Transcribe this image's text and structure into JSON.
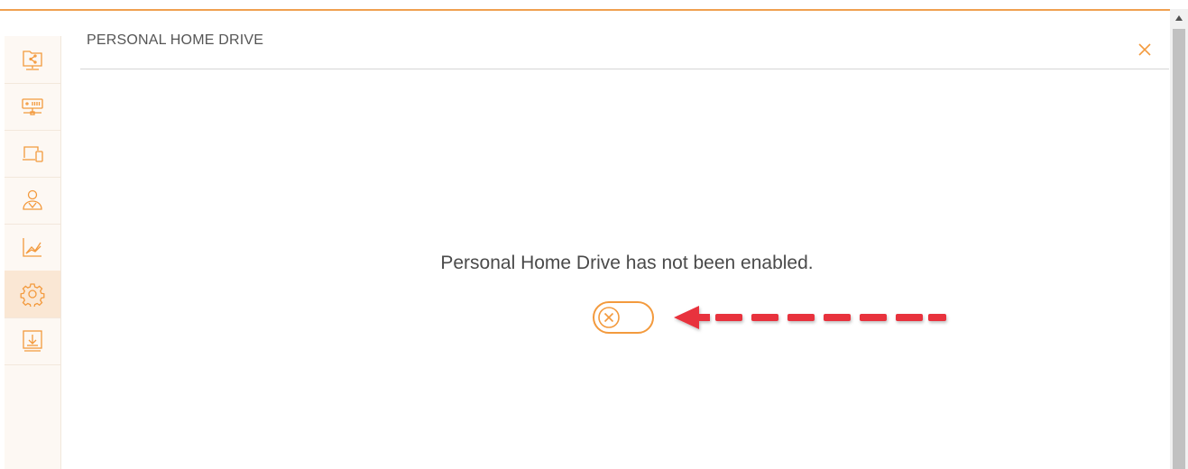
{
  "panel": {
    "title": "PERSONAL HOME DRIVE",
    "close_icon": "close-icon",
    "message": "Personal Home Drive has not been enabled.",
    "toggle": {
      "state": "off",
      "icon": "x-circle-icon"
    }
  },
  "sidebar": {
    "items": [
      {
        "icon": "network-share-icon",
        "active": false
      },
      {
        "icon": "server-icon",
        "active": false
      },
      {
        "icon": "devices-icon",
        "active": false
      },
      {
        "icon": "users-icon",
        "active": false
      },
      {
        "icon": "chart-icon",
        "active": false
      },
      {
        "icon": "gear-icon",
        "active": true
      },
      {
        "icon": "download-icon",
        "active": false
      }
    ]
  },
  "colors": {
    "accent": "#f39a3d",
    "annotation_arrow": "#e8323c",
    "active_sidebar_bg": "#fae7d4"
  }
}
